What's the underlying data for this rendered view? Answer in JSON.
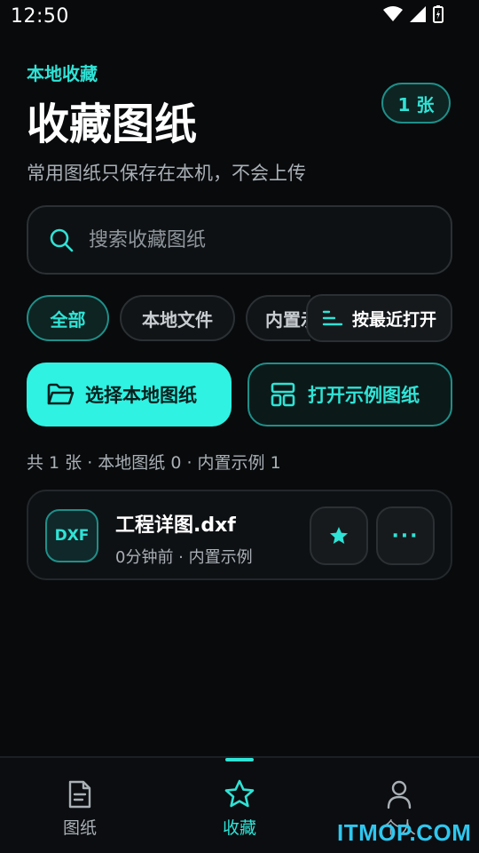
{
  "status_bar": {
    "time": "12:50"
  },
  "header": {
    "section_label": "本地收藏",
    "title": "收藏图纸",
    "count_badge": "1 张",
    "subtitle": "常用图纸只保存在本机，不会上传"
  },
  "search": {
    "placeholder": "搜索收藏图纸",
    "value": ""
  },
  "filters": {
    "chips": [
      {
        "label": "全部",
        "active": true
      },
      {
        "label": "本地文件",
        "active": false
      },
      {
        "label": "内置示例",
        "active": false
      }
    ],
    "sort_label": "按最近打开"
  },
  "actions": {
    "pick_local": "选择本地图纸",
    "open_sample": "打开示例图纸"
  },
  "stats": "共 1 张 · 本地图纸 0 · 内置示例 1",
  "files": [
    {
      "type_badge": "DXF",
      "name": "工程详图.dxf",
      "meta": "0分钟前 · 内置示例",
      "more_label": "···"
    }
  ],
  "bottom_nav": {
    "items": [
      {
        "label": "图纸",
        "icon": "document-icon",
        "active": false
      },
      {
        "label": "收藏",
        "icon": "star-outline-icon",
        "active": true
      },
      {
        "label": "个人",
        "icon": "person-icon",
        "active": false
      }
    ]
  },
  "watermark": "ITMOP.COM",
  "colors": {
    "accent": "#2fe3d6",
    "button_fill": "#2ff2e2",
    "background": "#080a0c"
  }
}
